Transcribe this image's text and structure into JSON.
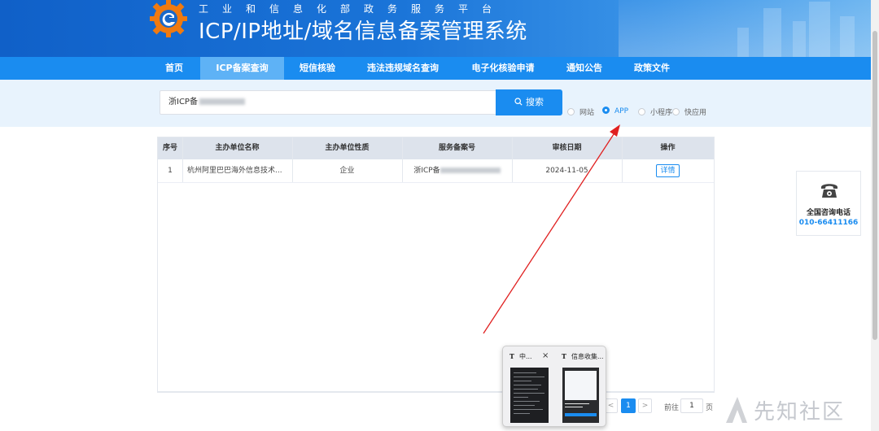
{
  "header": {
    "subtitle": "工业和信息化部政务服务平台",
    "title": "ICP/IP地址/域名信息备案管理系统"
  },
  "nav": {
    "items": [
      {
        "label": "首页"
      },
      {
        "label": "ICP备案查询",
        "active": true
      },
      {
        "label": "短信核验"
      },
      {
        "label": "违法违规域名查询"
      },
      {
        "label": "电子化核验申请"
      },
      {
        "label": "通知公告"
      },
      {
        "label": "政策文件"
      }
    ]
  },
  "search": {
    "value_prefix": "浙ICP备",
    "button_label": "搜索",
    "types": [
      {
        "label": "网站",
        "checked": false
      },
      {
        "label": "APP",
        "checked": true
      },
      {
        "label": "小程序",
        "checked": false
      },
      {
        "label": "快应用",
        "checked": false
      }
    ]
  },
  "table": {
    "headers": [
      "序号",
      "主办单位名称",
      "主办单位性质",
      "服务备案号",
      "审核日期",
      "操作"
    ],
    "rows": [
      {
        "index": "1",
        "org_name": "杭州阿里巴巴海外信息技术...",
        "org_type": "企业",
        "record_prefix": "浙ICP备",
        "date": "2024-11-05",
        "action": "详情"
      }
    ]
  },
  "pagination": {
    "prev": "<",
    "current_page": "1",
    "next": ">",
    "goto_label": "前往",
    "goto_value": "1",
    "page_unit": "页"
  },
  "consult": {
    "label": "全国咨询电话",
    "phone": "010-66411166"
  },
  "taskbar_preview": {
    "tabs": [
      {
        "icon": "T",
        "title": "中..."
      },
      {
        "icon": "T",
        "title": "信息收集..."
      }
    ],
    "close": "×"
  },
  "watermark": {
    "text": "先知社区"
  },
  "colors": {
    "brand_blue": "#1a8cf0",
    "nav_active": "#5eb2f6",
    "search_band": "#e8f3fd",
    "annotation_red": "#e02020"
  }
}
